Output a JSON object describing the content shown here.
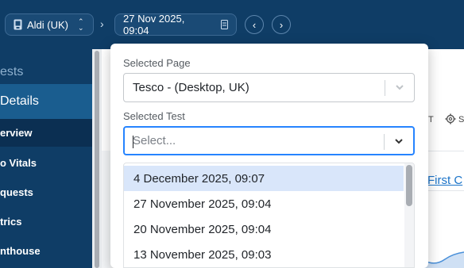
{
  "topbar": {
    "site_selector": "Aldi (UK)",
    "date_selector": "27 Nov 2025, 09:04",
    "prev_label": "‹",
    "next_label": "›"
  },
  "sidebar": {
    "top_item": "ests",
    "section": "Details",
    "items": [
      "erview",
      "o Vitals",
      "quests",
      "trics",
      "nthouse"
    ]
  },
  "background": {
    "link_text": "First C",
    "toolbar_letter": "T",
    "settings_letter": "S"
  },
  "popup": {
    "page_label": "Selected Page",
    "page_value": "Tesco - (Desktop, UK)",
    "test_label": "Selected Test",
    "test_placeholder": "Select...",
    "options": [
      "4 December 2025, 09:07",
      "27 November 2025, 09:04",
      "20 November 2025, 09:04",
      "13 November 2025, 09:03"
    ]
  },
  "colors": {
    "navy": "#0f3d66",
    "focus": "#2684ff",
    "highlight": "#d9e6fa"
  }
}
